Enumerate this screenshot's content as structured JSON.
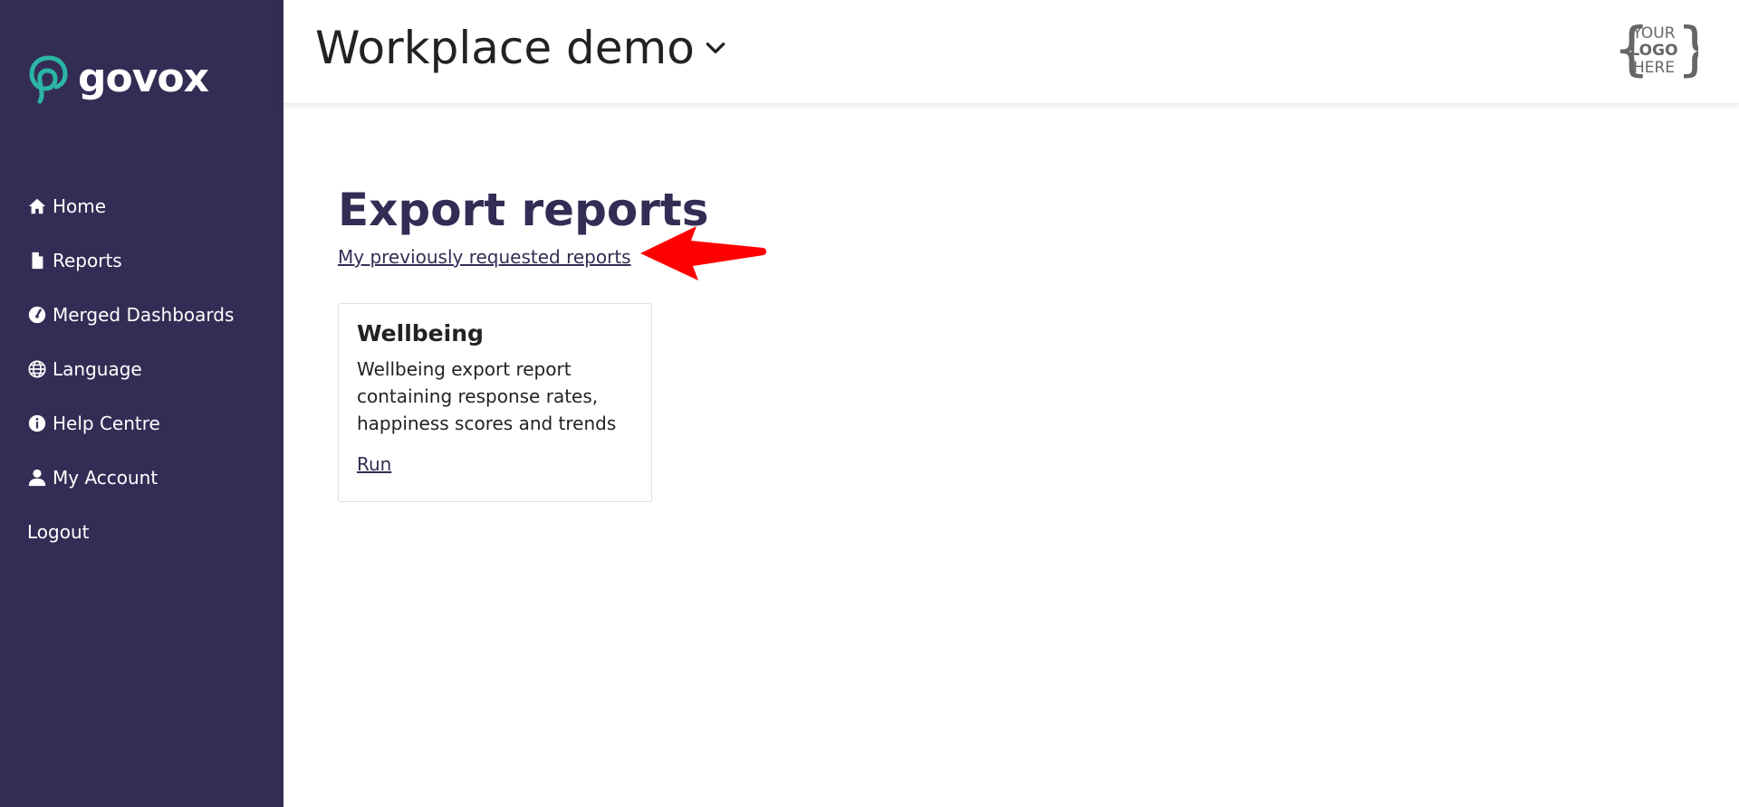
{
  "brand": {
    "name": "govox",
    "accent": "#2bb5a5",
    "sidebar_bg": "#332d55"
  },
  "sidebar": {
    "items": [
      {
        "label": "Home",
        "icon": "home-icon"
      },
      {
        "label": "Reports",
        "icon": "document-icon"
      },
      {
        "label": "Merged Dashboards",
        "icon": "gauge-icon"
      },
      {
        "label": "Language",
        "icon": "globe-icon"
      },
      {
        "label": "Help Centre",
        "icon": "info-icon"
      },
      {
        "label": "My Account",
        "icon": "user-icon"
      },
      {
        "label": "Logout",
        "icon": ""
      }
    ]
  },
  "header": {
    "workspace": "Workplace demo",
    "logo_lines": [
      "YOUR",
      "LOGO",
      "HERE"
    ]
  },
  "main": {
    "title": "Export reports",
    "previous_link": "My previously requested reports",
    "cards": [
      {
        "title": "Wellbeing",
        "description": "Wellbeing export report containing response rates, happiness scores and trends",
        "action": "Run"
      }
    ]
  },
  "annotation": {
    "color": "#ff0000",
    "icon": "red-arrow-icon"
  }
}
